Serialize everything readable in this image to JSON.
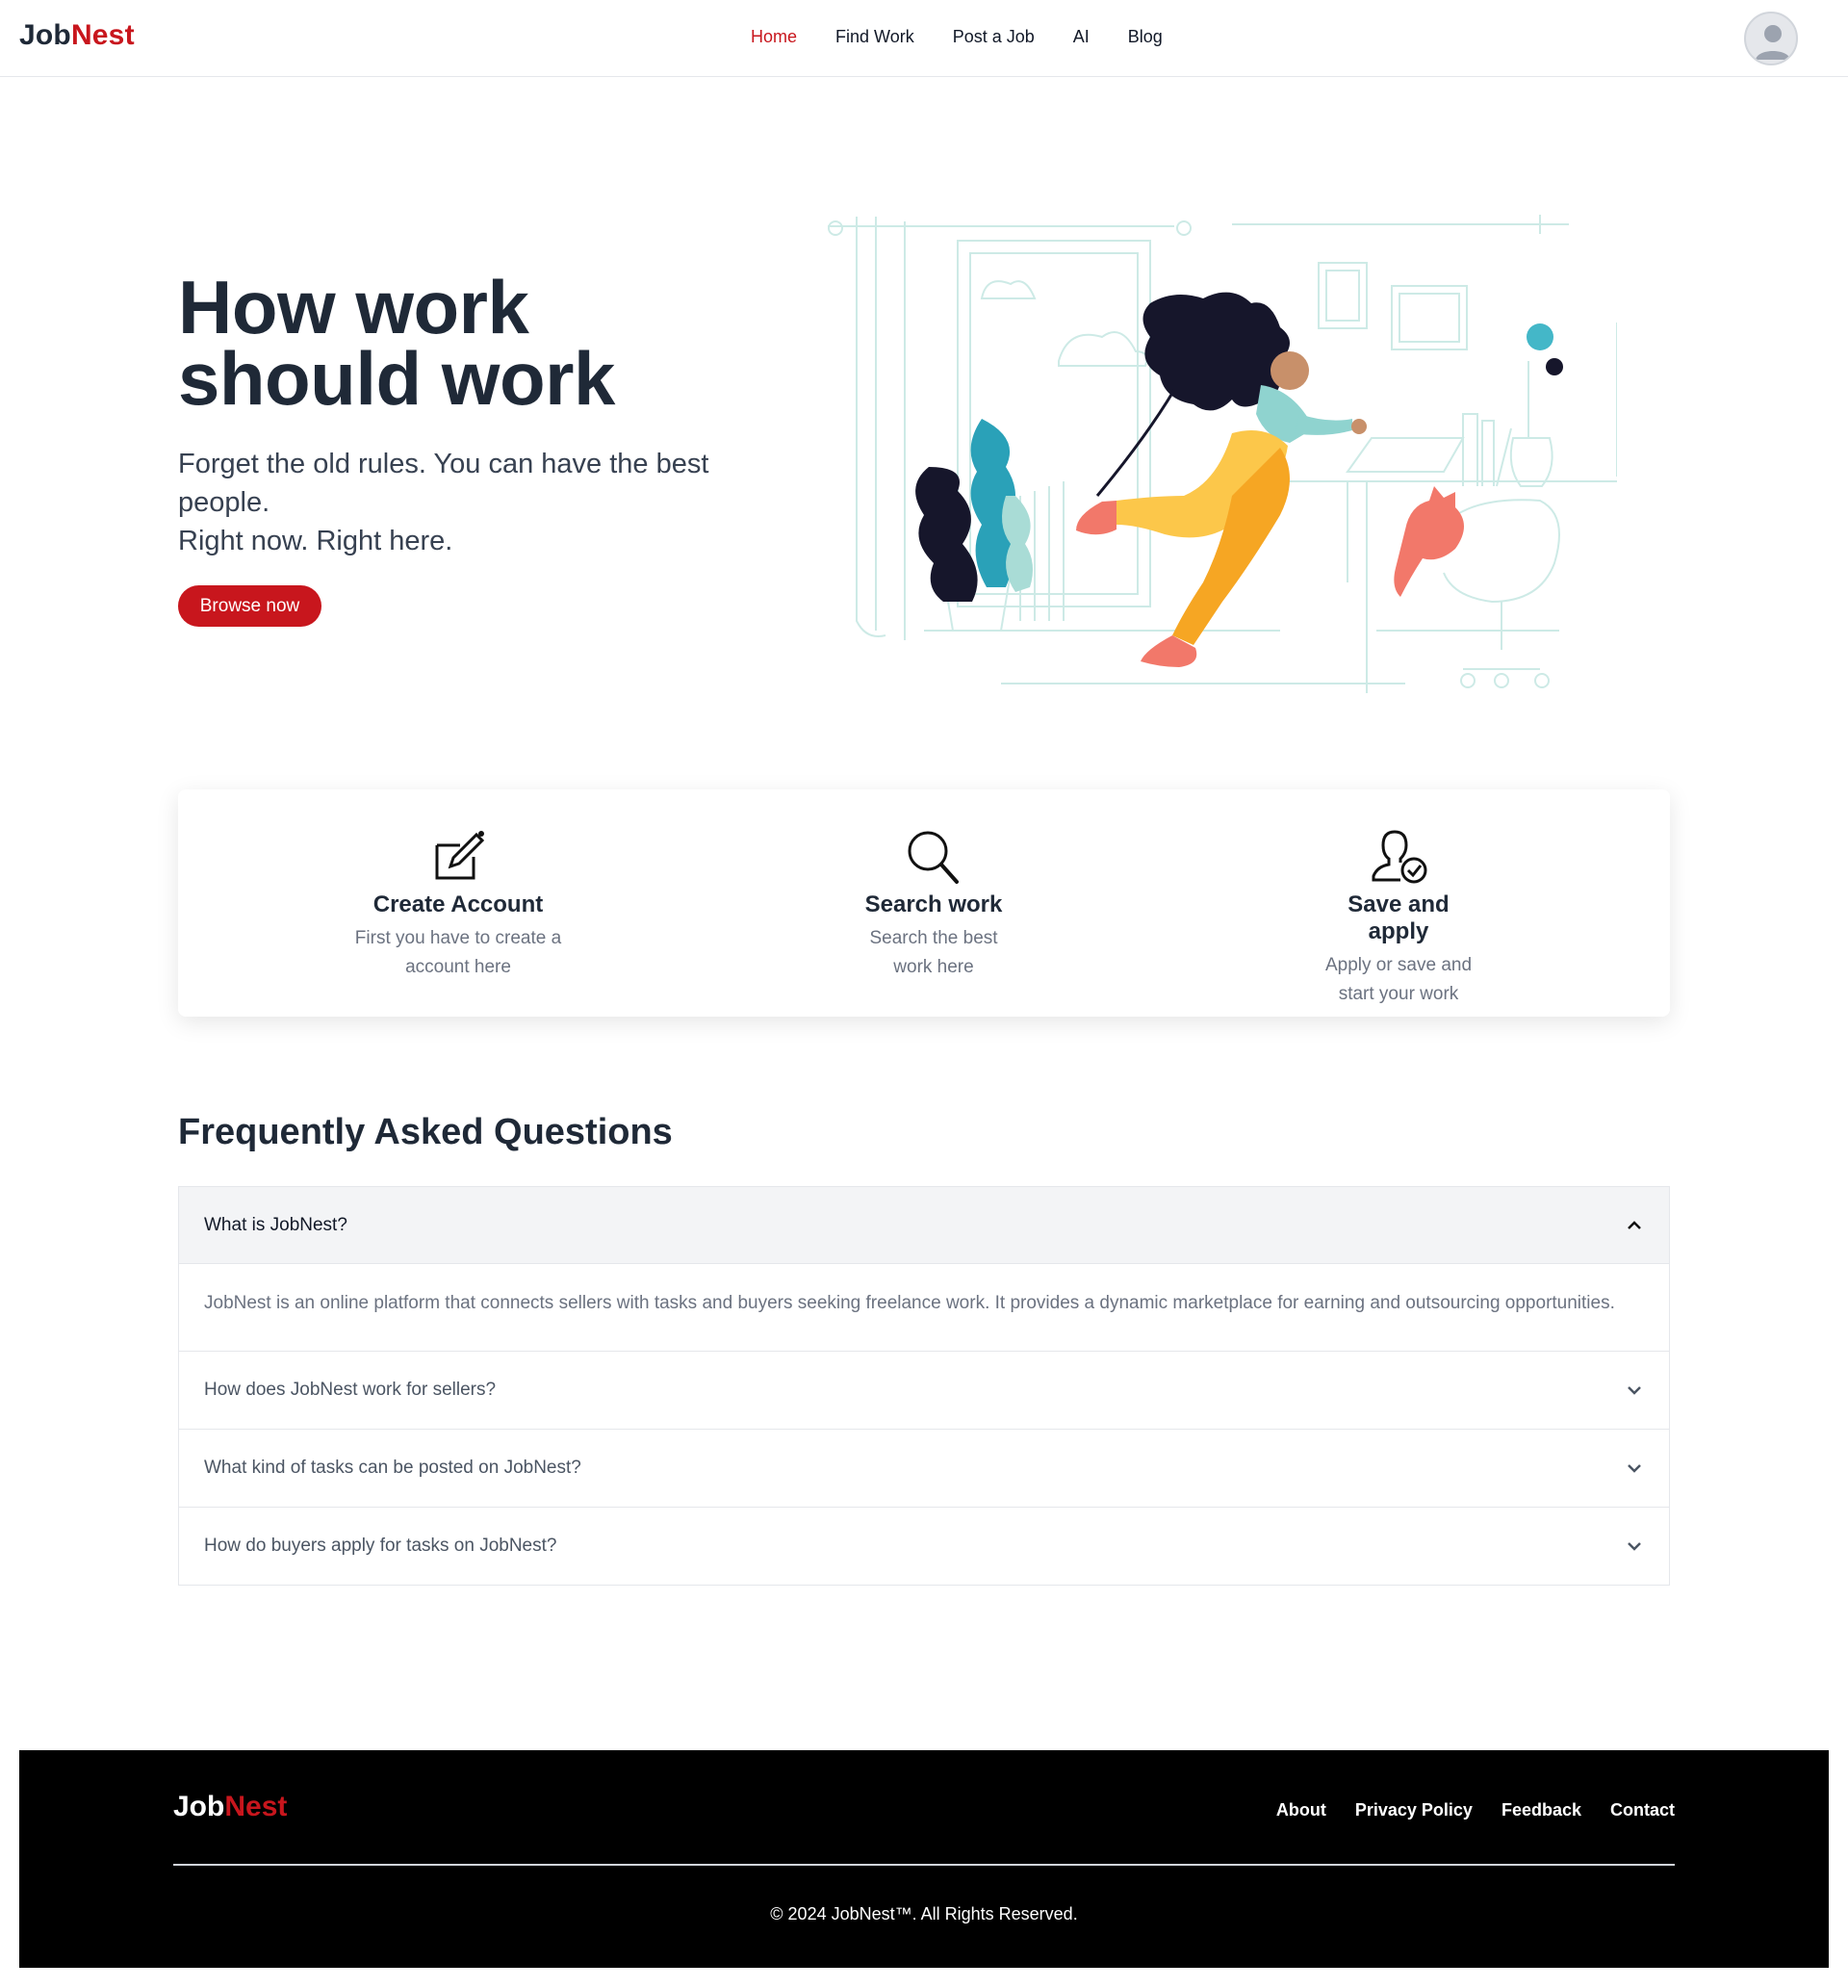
{
  "brand": {
    "part1": "Job",
    "part2": "Nest",
    "accent": "#c8161d"
  },
  "nav": {
    "items": [
      {
        "label": "Home",
        "active": true
      },
      {
        "label": "Find Work"
      },
      {
        "label": "Post a Job"
      },
      {
        "label": "AI"
      },
      {
        "label": "Blog"
      }
    ],
    "avatar_icon": "user-avatar-icon"
  },
  "hero": {
    "title_line1": "How work",
    "title_line2": "should work",
    "subtitle_line1": "Forget the old rules. You can have the best people.",
    "subtitle_line2": "Right now. Right here.",
    "button": "Browse now",
    "illustration": "woman-flying-to-desk-illustration"
  },
  "steps": [
    {
      "icon": "edit-icon",
      "title": "Create Account",
      "desc": "First you have to create a account here"
    },
    {
      "icon": "search-icon",
      "title": "Search work",
      "desc": "Search the best work here"
    },
    {
      "icon": "user-check-icon",
      "title": "Save and apply",
      "desc": "Apply or save and start your work"
    }
  ],
  "faq": {
    "title": "Frequently Asked Questions",
    "items": [
      {
        "q": "What is JobNest?",
        "a": "JobNest is an online platform that connects sellers with tasks and buyers seeking freelance work. It provides a dynamic marketplace for earning and outsourcing opportunities.",
        "open": true
      },
      {
        "q": "How does JobNest work for sellers?",
        "open": false
      },
      {
        "q": "What kind of tasks can be posted on JobNest?",
        "open": false
      },
      {
        "q": "How do buyers apply for tasks on JobNest?",
        "open": false
      }
    ]
  },
  "footer": {
    "links": [
      "About",
      "Privacy Policy",
      "Feedback",
      "Contact"
    ],
    "copyright": "© 2024 JobNest™. All Rights Reserved."
  }
}
